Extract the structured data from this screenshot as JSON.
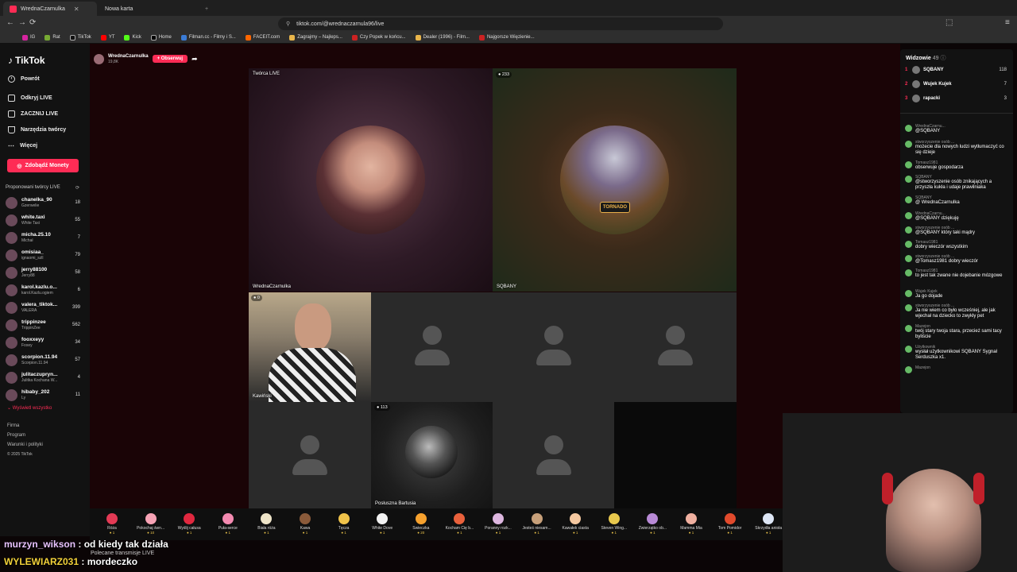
{
  "browser": {
    "tabs": [
      {
        "title": "WrednaCzarnulka",
        "active": true
      },
      {
        "title": "Nowa karta",
        "active": false
      }
    ],
    "url": "tiktok.com/@wrednaczarnula96/live",
    "bookmarks": [
      "IG",
      "Rat",
      "TikTok",
      "YT",
      "Kick",
      "Home",
      "Filman.cc - Filmy i S...",
      "FACEIT.com",
      "Zagrajmy – Najleps...",
      "Czy Popek w końcu...",
      "Dealer (1996) - Film...",
      "Najgorsze Więzienie..."
    ]
  },
  "sidebar": {
    "logo": "TikTok",
    "nav": [
      {
        "label": "Powrót",
        "icon": "back-arrow-icon"
      },
      {
        "label": "Odkryj LIVE",
        "icon": "live-icon"
      },
      {
        "label": "ZACZNIJ LIVE",
        "icon": "video-icon"
      },
      {
        "label": "Narzędzia twórcy",
        "icon": "creator-tools-icon"
      },
      {
        "label": "Więcej",
        "icon": "more-icon"
      }
    ],
    "coins_button": "Zdobądź Monety",
    "suggested_header": "Proponowani twórcy LIVE",
    "creators": [
      {
        "name": "chanelka_90",
        "sub": "Gzerwelie",
        "count": "18"
      },
      {
        "name": "white.taxi",
        "sub": "White Taxi",
        "count": "55"
      },
      {
        "name": "micha.25.10",
        "sub": "Michał",
        "count": "7"
      },
      {
        "name": "omisiaa_",
        "sub": "ignaomi_szll",
        "count": "79"
      },
      {
        "name": "jerry88100",
        "sub": "Jerry88",
        "count": "58"
      },
      {
        "name": "karol.kazlu.o...",
        "sub": "karol.Kazlu.ogiem",
        "count": "6"
      },
      {
        "name": "valera_tiktok...",
        "sub": "VALERA",
        "count": "399"
      },
      {
        "name": "trippinzee",
        "sub": "TrippinZee",
        "count": "562"
      },
      {
        "name": "fooxxeyy",
        "sub": "Foxey",
        "count": "34"
      },
      {
        "name": "scorpion.11.94",
        "sub": "Scorpion.11.94",
        "count": "57"
      },
      {
        "name": "julitaczupryn...",
        "sub": "Julitka Kochana W...",
        "count": "4"
      },
      {
        "name": "hibaby_202",
        "sub": "Ly",
        "count": "11"
      }
    ],
    "show_all": "Wyświetl wszystko",
    "footer": [
      "Firma",
      "Program",
      "Warunki i polityki",
      "© 2025 TikTok"
    ]
  },
  "host": {
    "name": "WrednaCzarnulka",
    "followers": "19,8K",
    "follow_button": "+ Obserwuj"
  },
  "grid": {
    "main_label": "Twórca LIVE",
    "main_name": "WrednaCzarnulka",
    "guest1_count": "233",
    "guest1_name": "SQBANY",
    "guest1_sign": "TORNADO",
    "guest2_count": "0",
    "guest2_name": "Kawiński",
    "guest3_count": "113",
    "guest3_name": "Posłuszna Bartusia"
  },
  "gifts": [
    {
      "name": "Róża",
      "price": "1",
      "color": "#e33a55"
    },
    {
      "name": "Pokochaj śwn...",
      "price": "10",
      "color": "#f7a3b5"
    },
    {
      "name": "Wyślij całusa",
      "price": "1",
      "color": "#e0283f"
    },
    {
      "name": "Puła-serce",
      "price": "1",
      "color": "#f38ab0"
    },
    {
      "name": "Biała róża",
      "price": "1",
      "color": "#eee4c8"
    },
    {
      "name": "Kawa",
      "price": "1",
      "color": "#8a5a3a"
    },
    {
      "name": "Tęcza",
      "price": "1",
      "color": "#f0c34a"
    },
    {
      "name": "White Dove",
      "price": "1",
      "color": "#f2f2f2"
    },
    {
      "name": "Świeczka",
      "price": "20",
      "color": "#f6a12e"
    },
    {
      "name": "Kocham Cię b...",
      "price": "1",
      "color": "#e9613c"
    },
    {
      "name": "Poranny rozk...",
      "price": "1",
      "color": "#ddb7e0"
    },
    {
      "name": "Jesteś niesam...",
      "price": "1",
      "color": "#c7a07a"
    },
    {
      "name": "Kawałek ciasta",
      "price": "1",
      "color": "#f5c8a0"
    },
    {
      "name": "Steven Wing...",
      "price": "1",
      "color": "#e8c84d"
    },
    {
      "name": "Zwierzątko ob...",
      "price": "1",
      "color": "#b88ad6"
    },
    {
      "name": "Mamma Mia",
      "price": "1",
      "color": "#f0b0a0"
    },
    {
      "name": "Tom Pomidor",
      "price": "1",
      "color": "#e14a2c"
    },
    {
      "name": "Skrzydła anioła",
      "price": "1",
      "color": "#dde6f5"
    }
  ],
  "recommended": "Polecane transmisje LIVE",
  "viewers": {
    "title": "Widzowie",
    "count": "49",
    "top": [
      {
        "rank": "1",
        "name": "SQBANY",
        "score": "118"
      },
      {
        "rank": "2",
        "name": "Wujek Kujek",
        "score": "7"
      },
      {
        "rank": "3",
        "name": "rapacki",
        "score": "3"
      }
    ]
  },
  "chat": [
    {
      "user": "WrednaCzarnu...",
      "text": "@SQBANY"
    },
    {
      "user": "stworzyszenie osób ...",
      "text": "możecie dla nowych ludzi wytłumaczyć co się dzieje"
    },
    {
      "user": "Tomasz1981",
      "text": "obserwuje gospodarza"
    },
    {
      "user": "SQBANY",
      "text": "@stworzyszenie osób znikających a przyszła kukła i udaje prawilniaka"
    },
    {
      "user": "SQBANY",
      "text": "@ WrednaCzarnulka"
    },
    {
      "user": "WrednaCzarnu...",
      "text": "@SQBANY dziękuję"
    },
    {
      "user": "stworzyszenie osób ...",
      "text": "@SQBANY który taki mądry"
    },
    {
      "user": "Tomasz1981",
      "text": "dobry wieczór wszystkim"
    },
    {
      "user": "stworzyszenie osób ...",
      "text": "@Tomasz1981 dobry wieczór"
    },
    {
      "user": "Tomasz1981",
      "text": "to jest tak zwane nie dojebanie mózgowe"
    },
    {
      "user": "Wujek Kujek",
      "text": "Ja go dojade"
    },
    {
      "user": "stworzyszenie osób ...",
      "text": "Ja nie wiem co było wcześniej, ale jak wjechał na dziecko to zwykły pet"
    },
    {
      "user": "Mazejon",
      "text": "twój stary twoja stara, przecież sami tacy byliście"
    },
    {
      "user": "Użytkownik",
      "text": "wysłał użytkownikowi SQBANY Sygnał Serduszka x1."
    },
    {
      "user": "Mazejon",
      "text": ""
    }
  ],
  "stream_chat": [
    {
      "user": "murzyn_wikson",
      "text": "od kiedy tak działa"
    },
    {
      "user": "WYLEWIARZ031",
      "text": "mordeczko"
    }
  ]
}
